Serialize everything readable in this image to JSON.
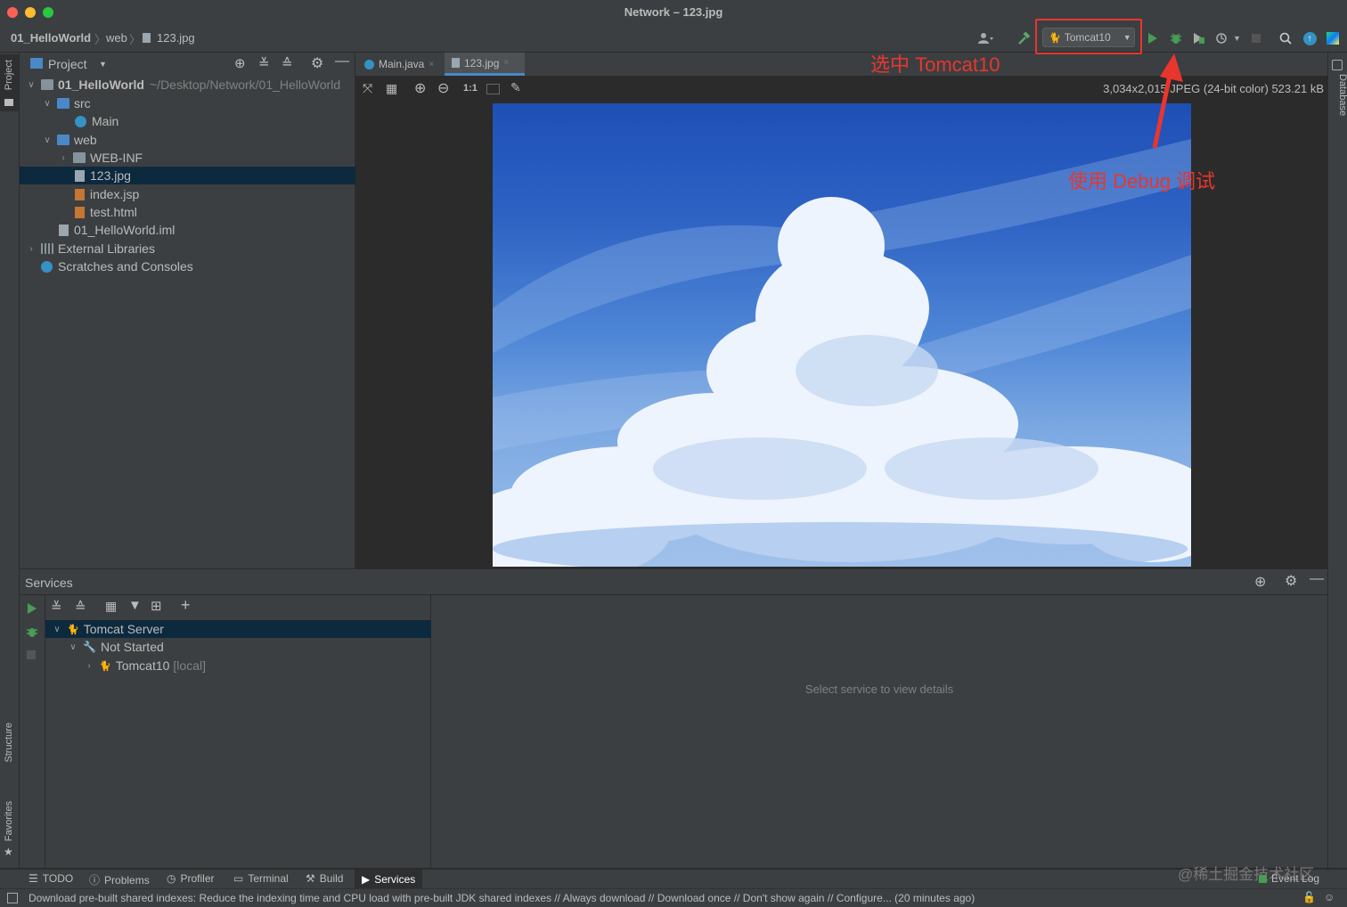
{
  "window": {
    "title": "Network – 123.jpg"
  },
  "breadcrumb": [
    "01_HelloWorld",
    "web",
    "123.jpg"
  ],
  "toolbar": {
    "run_config": "Tomcat10"
  },
  "project_panel": {
    "title": "Project",
    "tree": [
      {
        "label": "01_HelloWorld",
        "path": "~/Desktop/Network/01_HelloWorld"
      },
      {
        "label": "src"
      },
      {
        "label": "Main"
      },
      {
        "label": "web"
      },
      {
        "label": "WEB-INF"
      },
      {
        "label": "123.jpg"
      },
      {
        "label": "index.jsp"
      },
      {
        "label": "test.html"
      },
      {
        "label": "01_HelloWorld.iml"
      },
      {
        "label": "External Libraries"
      },
      {
        "label": "Scratches and Consoles"
      }
    ]
  },
  "editor": {
    "tabs": [
      "Main.java",
      "123.jpg"
    ],
    "zoom_actual": "1:1",
    "image_info": "3,034x2,015 JPEG (24-bit color) 523.21 kB"
  },
  "annotations": {
    "select": "选中 Tomcat10",
    "debug": "使用 Debug 调试"
  },
  "services": {
    "title": "Services",
    "tree": [
      {
        "label": "Tomcat Server"
      },
      {
        "label": "Not Started"
      },
      {
        "label": "Tomcat10",
        "suffix": "[local]"
      }
    ],
    "empty_detail": "Select service to view details"
  },
  "left_stripe": {
    "project": "Project",
    "structure": "Structure",
    "favorites": "Favorites"
  },
  "right_stripe": {
    "database": "Database"
  },
  "tool_windows": [
    "TODO",
    "Problems",
    "Profiler",
    "Terminal",
    "Build",
    "Services"
  ],
  "event_log": "Event Log",
  "watermark": "@稀土掘金技术社区",
  "status": "Download pre-built shared indexes: Reduce the indexing time and CPU load with pre-built JDK shared indexes // Always download // Download once // Don't show again // Configure... (20 minutes ago)"
}
